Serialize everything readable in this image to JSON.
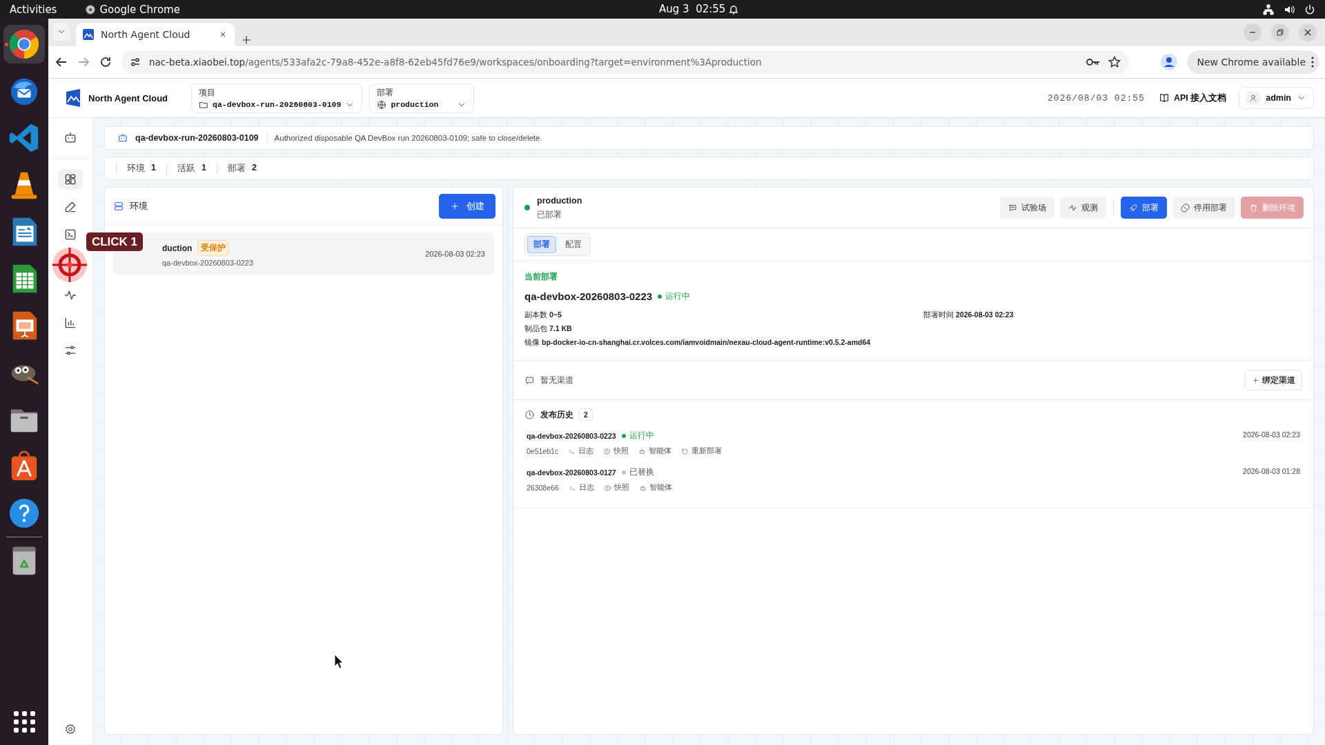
{
  "os": {
    "activities": "Activities",
    "app": "Google Chrome",
    "clock": "Aug 3  02:55"
  },
  "dock": [
    {
      "kind": "browser",
      "running": true
    },
    {
      "kind": "mail",
      "running": false
    },
    {
      "kind": "code",
      "running": false
    },
    {
      "kind": "cone",
      "running": false
    },
    {
      "kind": "writer",
      "running": false
    },
    {
      "kind": "sheet",
      "running": false
    },
    {
      "kind": "slides",
      "running": false
    },
    {
      "kind": "paint",
      "running": false
    },
    {
      "kind": "files",
      "running": false
    },
    {
      "kind": "store",
      "running": false
    },
    {
      "kind": "help",
      "running": false
    },
    {
      "kind": "trash",
      "running": false
    }
  ],
  "browser": {
    "tab_title": "North Agent Cloud",
    "url_host": "nac-beta.xiaobei.top",
    "url_path": "/agents/533afa2c-79a8-452e-a8f8-62eb45fd76e9/workspaces/onboarding?target=environment%3Aproduction",
    "update_button": "New Chrome available"
  },
  "header": {
    "brand": "North Agent Cloud",
    "project_label": "项目",
    "project": "qa-devbox-run-20260803-0109",
    "deploy_label": "部署",
    "deploy": "production",
    "timestamp": "2026/08/03 02:55",
    "api_docs": "API 接入文档",
    "user": "admin"
  },
  "rail": [
    {
      "kind": "dashboard",
      "selected": true
    },
    {
      "kind": "edit",
      "selected": false
    },
    {
      "kind": "terminal",
      "selected": false
    },
    {
      "kind": "activity",
      "selected": false
    },
    {
      "kind": "chart",
      "selected": false
    },
    {
      "kind": "sliders",
      "selected": false
    }
  ],
  "banner": {
    "name": "qa-devbox-run-20260803-0109",
    "description": "Authorized disposable QA DevBox run 20260803-0109; safe to close/delete."
  },
  "stats": [
    {
      "label": "环境",
      "value": "1"
    },
    {
      "label": "活跃",
      "value": "1"
    },
    {
      "label": "部署",
      "value": "2"
    }
  ],
  "environments": {
    "title": "环境",
    "create_button": "创建",
    "items": [
      {
        "name": "duction",
        "badge": "受保护",
        "deployment": "qa-devbox-20260803-0223",
        "time": "2026-08-03 02:23"
      }
    ]
  },
  "detail": {
    "name": "production",
    "status": "已部署",
    "actions": [
      {
        "label": "试验场",
        "kind": "playground",
        "primary": false,
        "disabled": false
      },
      {
        "label": "观测",
        "kind": "observe",
        "primary": false,
        "disabled": false
      },
      {
        "label": "部署",
        "kind": "deploy",
        "primary": true,
        "disabled": false
      },
      {
        "label": "停用部署",
        "kind": "stop",
        "primary": false,
        "disabled": false
      },
      {
        "label": "删除环境",
        "kind": "delete",
        "primary": false,
        "disabled": true
      }
    ],
    "tabs": [
      {
        "label": "部署",
        "selected": true
      },
      {
        "label": "配置",
        "selected": false
      }
    ],
    "current": {
      "heading": "当前部署",
      "name": "qa-devbox-20260803-0223",
      "status": "运行中",
      "fields": [
        {
          "label": "副本数",
          "value": "0~5"
        },
        {
          "label": "部署时间",
          "value": "2026-08-03 02:23"
        },
        {
          "label": "制品包",
          "value": "7.1 KB"
        },
        {
          "label": "镜像",
          "value": "bp-docker-io-cn-shanghai.cr.volces.com/iamvoidmain/nexau-cloud-agent-runtime:v0.5.2-amd64"
        }
      ]
    },
    "channels": {
      "empty": "暂无渠道",
      "bind_button": "绑定渠道"
    },
    "history": {
      "title": "发布历史",
      "count": "2",
      "items": [
        {
          "name": "qa-devbox-20260803-0223",
          "status": "运行中",
          "active": true,
          "commit": "0e51eb1c",
          "time": "2026-08-03 02:23",
          "links": [
            {
              "label": "日志",
              "kind": "logs"
            },
            {
              "label": "快照",
              "kind": "snapshot"
            },
            {
              "label": "智能体",
              "kind": "agent"
            },
            {
              "label": "重新部署",
              "kind": "redeploy"
            }
          ]
        },
        {
          "name": "qa-devbox-20260803-0127",
          "status": "已替换",
          "active": false,
          "commit": "26308e66",
          "time": "2026-08-03 01:28",
          "links": [
            {
              "label": "日志",
              "kind": "logs"
            },
            {
              "label": "快照",
              "kind": "snapshot"
            },
            {
              "label": "智能体",
              "kind": "agent"
            }
          ]
        }
      ]
    }
  },
  "overlay": {
    "label": "CLICK 1"
  }
}
